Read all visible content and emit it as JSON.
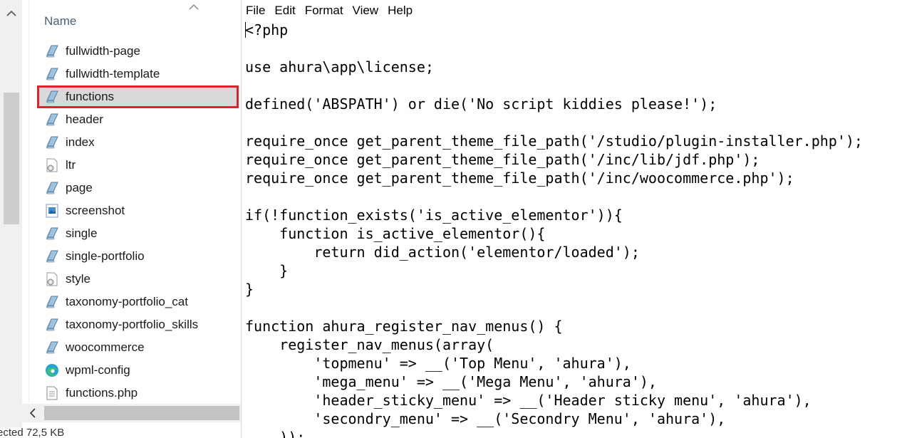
{
  "explorer": {
    "column_header": "Name",
    "files": [
      {
        "name": "fullwidth-page",
        "icon": "php-file-icon"
      },
      {
        "name": "fullwidth-template",
        "icon": "php-file-icon"
      },
      {
        "name": "functions",
        "icon": "php-file-icon",
        "selected": true
      },
      {
        "name": "header",
        "icon": "php-file-icon"
      },
      {
        "name": "index",
        "icon": "php-file-icon"
      },
      {
        "name": "ltr",
        "icon": "css-file-icon"
      },
      {
        "name": "page",
        "icon": "php-file-icon"
      },
      {
        "name": "screenshot",
        "icon": "image-file-icon"
      },
      {
        "name": "single",
        "icon": "php-file-icon"
      },
      {
        "name": "single-portfolio",
        "icon": "php-file-icon"
      },
      {
        "name": "style",
        "icon": "css-file-icon"
      },
      {
        "name": "taxonomy-portfolio_cat",
        "icon": "php-file-icon"
      },
      {
        "name": "taxonomy-portfolio_skills",
        "icon": "php-file-icon"
      },
      {
        "name": "woocommerce",
        "icon": "php-file-icon"
      },
      {
        "name": "wpml-config",
        "icon": "edge-xml-file-icon"
      },
      {
        "name": "functions.php",
        "icon": "text-file-icon"
      }
    ],
    "status": "ected  72,5 KB",
    "selection_highlight_color": "#e0222b"
  },
  "notepad": {
    "menu": [
      "File",
      "Edit",
      "Format",
      "View",
      "Help"
    ],
    "lines": [
      "<?php",
      "",
      "use ahura\\app\\license;",
      "",
      "defined('ABSPATH') or die('No script kiddies please!');",
      "",
      "require_once get_parent_theme_file_path('/studio/plugin-installer.php');",
      "require_once get_parent_theme_file_path('/inc/lib/jdf.php');",
      "require_once get_parent_theme_file_path('/inc/woocommerce.php');",
      "",
      "if(!function_exists('is_active_elementor')){",
      "    function is_active_elementor(){",
      "        return did_action('elementor/loaded');",
      "    }",
      "}",
      "",
      "function ahura_register_nav_menus() {",
      "    register_nav_menus(array(",
      "        'topmenu' => __('Top Menu', 'ahura'),",
      "        'mega_menu' => __('Mega Menu', 'ahura'),",
      "        'header_sticky_menu' => __('Header sticky menu', 'ahura'),",
      "        'secondry_menu' => __('Secondry Menu', 'ahura'),",
      "    ));"
    ]
  }
}
